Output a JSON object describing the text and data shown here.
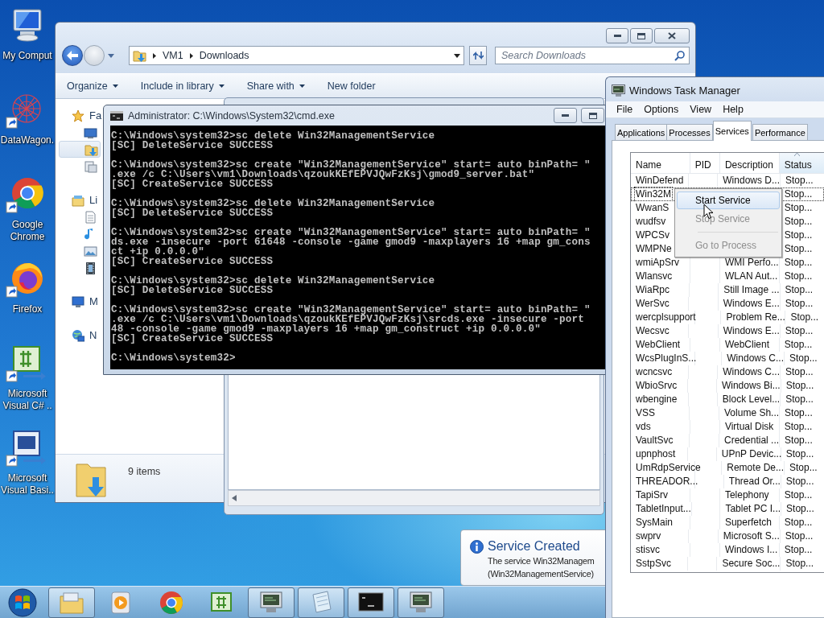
{
  "desktop": {
    "icons": [
      {
        "label": "My Comput",
        "kind": "computer",
        "shortcut": false
      },
      {
        "label": "DataWagon.",
        "kind": "network-sphere",
        "shortcut": true
      },
      {
        "label": "Google Chrome",
        "kind": "chrome",
        "shortcut": true
      },
      {
        "label": "Firefox",
        "kind": "firefox",
        "shortcut": true
      },
      {
        "label": "Microsoft Visual C# ..",
        "kind": "csharp",
        "shortcut": true
      },
      {
        "label": "Microsoft Visual Basi..",
        "kind": "vb",
        "shortcut": true
      }
    ]
  },
  "explorer": {
    "breadcrumb": [
      "VM1",
      "Downloads"
    ],
    "search": {
      "placeholder": "Search Downloads"
    },
    "toolbar": [
      {
        "label": "Organize",
        "dropdown": true
      },
      {
        "label": "Include in library",
        "dropdown": true
      },
      {
        "label": "Share with",
        "dropdown": true
      },
      {
        "label": "New folder",
        "dropdown": false
      }
    ],
    "nav": [
      {
        "label": "Fa",
        "kind": "favorites",
        "children": [
          {
            "kind": "desktop",
            "selected": false
          },
          {
            "kind": "downloads",
            "selected": true
          },
          {
            "kind": "recent",
            "selected": false
          }
        ]
      },
      {
        "label": "Li",
        "kind": "libraries",
        "children": [
          {
            "kind": "documents",
            "selected": false
          },
          {
            "kind": "music",
            "selected": false
          },
          {
            "kind": "pictures",
            "selected": false
          },
          {
            "kind": "videos",
            "selected": false
          }
        ]
      },
      {
        "label": "M",
        "kind": "computer"
      },
      {
        "label": "N",
        "kind": "network"
      }
    ],
    "details": {
      "count": "9 items"
    }
  },
  "console": {
    "title": "Administrator: C:\\Windows\\System32\\cmd.exe",
    "blocks": [
      [
        "C:\\Windows\\system32>sc delete Win32ManagementService",
        "[SC] DeleteService SUCCESS"
      ],
      [
        "C:\\Windows\\system32>sc create \"Win32ManagementService\" start= auto binPath= \"",
        ".exe /c C:\\Users\\vm1\\Downloads\\qzoukKEfEPVJQwFzKsj\\gmod9_server.bat\"",
        "[SC] CreateService SUCCESS"
      ],
      [
        "C:\\Windows\\system32>sc delete Win32ManagementService",
        "[SC] DeleteService SUCCESS"
      ],
      [
        "C:\\Windows\\system32>sc create \"Win32ManagementService\" start= auto binPath= \"",
        "ds.exe -insecure -port 61648 -console -game gmod9 -maxplayers 16 +map gm_cons",
        "ct +ip 0.0.0.0\"",
        "[SC] CreateService SUCCESS"
      ],
      [
        "C:\\Windows\\system32>sc delete Win32ManagementService",
        "[SC] DeleteService SUCCESS"
      ],
      [
        "C:\\Windows\\system32>sc create \"Win32ManagementService\" start= auto binPath= \"",
        ".exe /c C:\\Users\\vm1\\Downloads\\qzoukKEfEPVJQwFzKsj\\srcds.exe -insecure -port",
        "48 -console -game gmod9 -maxplayers 16 +map gm_construct +ip 0.0.0.0\"",
        "[SC] CreateService SUCCESS"
      ],
      [
        "C:\\Windows\\system32>"
      ]
    ]
  },
  "task_manager": {
    "title": "Windows Task Manager",
    "menu": [
      "File",
      "Options",
      "View",
      "Help"
    ],
    "tabs": [
      {
        "label": "Applications",
        "selected": false
      },
      {
        "label": "Processes",
        "selected": false
      },
      {
        "label": "Services",
        "selected": true
      },
      {
        "label": "Performance",
        "selected": false
      }
    ],
    "columns": [
      {
        "label": "Name",
        "sorted": false
      },
      {
        "label": "PID",
        "sorted": false
      },
      {
        "label": "Description",
        "sorted": false
      },
      {
        "label": "Status",
        "sorted": true
      }
    ],
    "rows": [
      {
        "name": "WinDefend",
        "description": "Windows D...",
        "status": "Stop...",
        "selected": false
      },
      {
        "name": "Win32M",
        "status": "Stop...",
        "selected": true
      },
      {
        "name": "WwanS",
        "status": "Stop...",
        "selected": false
      },
      {
        "name": "wudfsv",
        "status": "Stop...",
        "selected": false
      },
      {
        "name": "WPCSv",
        "status": "Stop...",
        "selected": false
      },
      {
        "name": "WMPNe",
        "status": "Stop...",
        "selected": false
      },
      {
        "name": "wmiApSrv",
        "description": "WMI Perfo...",
        "status": "Stop...",
        "selected": false
      },
      {
        "name": "Wlansvc",
        "description": "WLAN Aut...",
        "status": "Stop...",
        "selected": false
      },
      {
        "name": "WiaRpc",
        "description": "Still Image ...",
        "status": "Stop...",
        "selected": false
      },
      {
        "name": "WerSvc",
        "description": "Windows E...",
        "status": "Stop...",
        "selected": false
      },
      {
        "name": "wercplsupport",
        "description": "Problem Re...",
        "status": "Stop...",
        "selected": false
      },
      {
        "name": "Wecsvc",
        "description": "Windows E...",
        "status": "Stop...",
        "selected": false
      },
      {
        "name": "WebClient",
        "description": "WebClient",
        "status": "Stop...",
        "selected": false
      },
      {
        "name": "WcsPlugInS...",
        "description": "Windows C...",
        "status": "Stop...",
        "selected": false
      },
      {
        "name": "wcncsvc",
        "description": "Windows C...",
        "status": "Stop...",
        "selected": false
      },
      {
        "name": "WbioSrvc",
        "description": "Windows Bi...",
        "status": "Stop...",
        "selected": false
      },
      {
        "name": "wbengine",
        "description": "Block Level...",
        "status": "Stop...",
        "selected": false
      },
      {
        "name": "VSS",
        "description": "Volume Sh...",
        "status": "Stop...",
        "selected": false
      },
      {
        "name": "vds",
        "description": "Virtual Disk",
        "status": "Stop...",
        "selected": false
      },
      {
        "name": "VaultSvc",
        "description": "Credential ...",
        "status": "Stop...",
        "selected": false
      },
      {
        "name": "upnphost",
        "description": "UPnP Devic...",
        "status": "Stop...",
        "selected": false
      },
      {
        "name": "UmRdpService",
        "description": "Remote De...",
        "status": "Stop...",
        "selected": false
      },
      {
        "name": "THREADOR...",
        "description": "Thread Or...",
        "status": "Stop...",
        "selected": false
      },
      {
        "name": "TapiSrv",
        "description": "Telephony",
        "status": "Stop...",
        "selected": false
      },
      {
        "name": "TabletInput...",
        "description": "Tablet PC I...",
        "status": "Stop...",
        "selected": false
      },
      {
        "name": "SysMain",
        "description": "Superfetch",
        "status": "Stop...",
        "selected": false
      },
      {
        "name": "swprv",
        "description": "Microsoft S...",
        "status": "Stop...",
        "selected": false
      },
      {
        "name": "stisvc",
        "description": "Windows I...",
        "status": "Stop...",
        "selected": false
      },
      {
        "name": "SstpSvc",
        "description": "Secure Soc...",
        "status": "Stop...",
        "selected": false
      }
    ],
    "context_menu": [
      {
        "kind": "item",
        "label": "Start Service",
        "highlighted": true,
        "disabled": false
      },
      {
        "kind": "item",
        "label": "Stop Service",
        "highlighted": false,
        "disabled": true
      },
      {
        "kind": "separator"
      },
      {
        "kind": "item",
        "label": "Go to Process",
        "highlighted": false,
        "disabled": true
      }
    ]
  },
  "notification": {
    "title": "Service Created",
    "lines": [
      "The service Win32Managem",
      "(Win32ManagementService)"
    ]
  },
  "taskbar": {
    "items": [
      {
        "kind": "explorer",
        "running": true
      },
      {
        "kind": "media-player",
        "running": false
      },
      {
        "kind": "chrome",
        "running": false
      },
      {
        "kind": "csharp",
        "running": false
      },
      {
        "kind": "monitor",
        "running": true
      },
      {
        "kind": "notepad",
        "running": true
      },
      {
        "kind": "console",
        "running": true
      },
      {
        "kind": "monitor",
        "running": true
      }
    ]
  }
}
